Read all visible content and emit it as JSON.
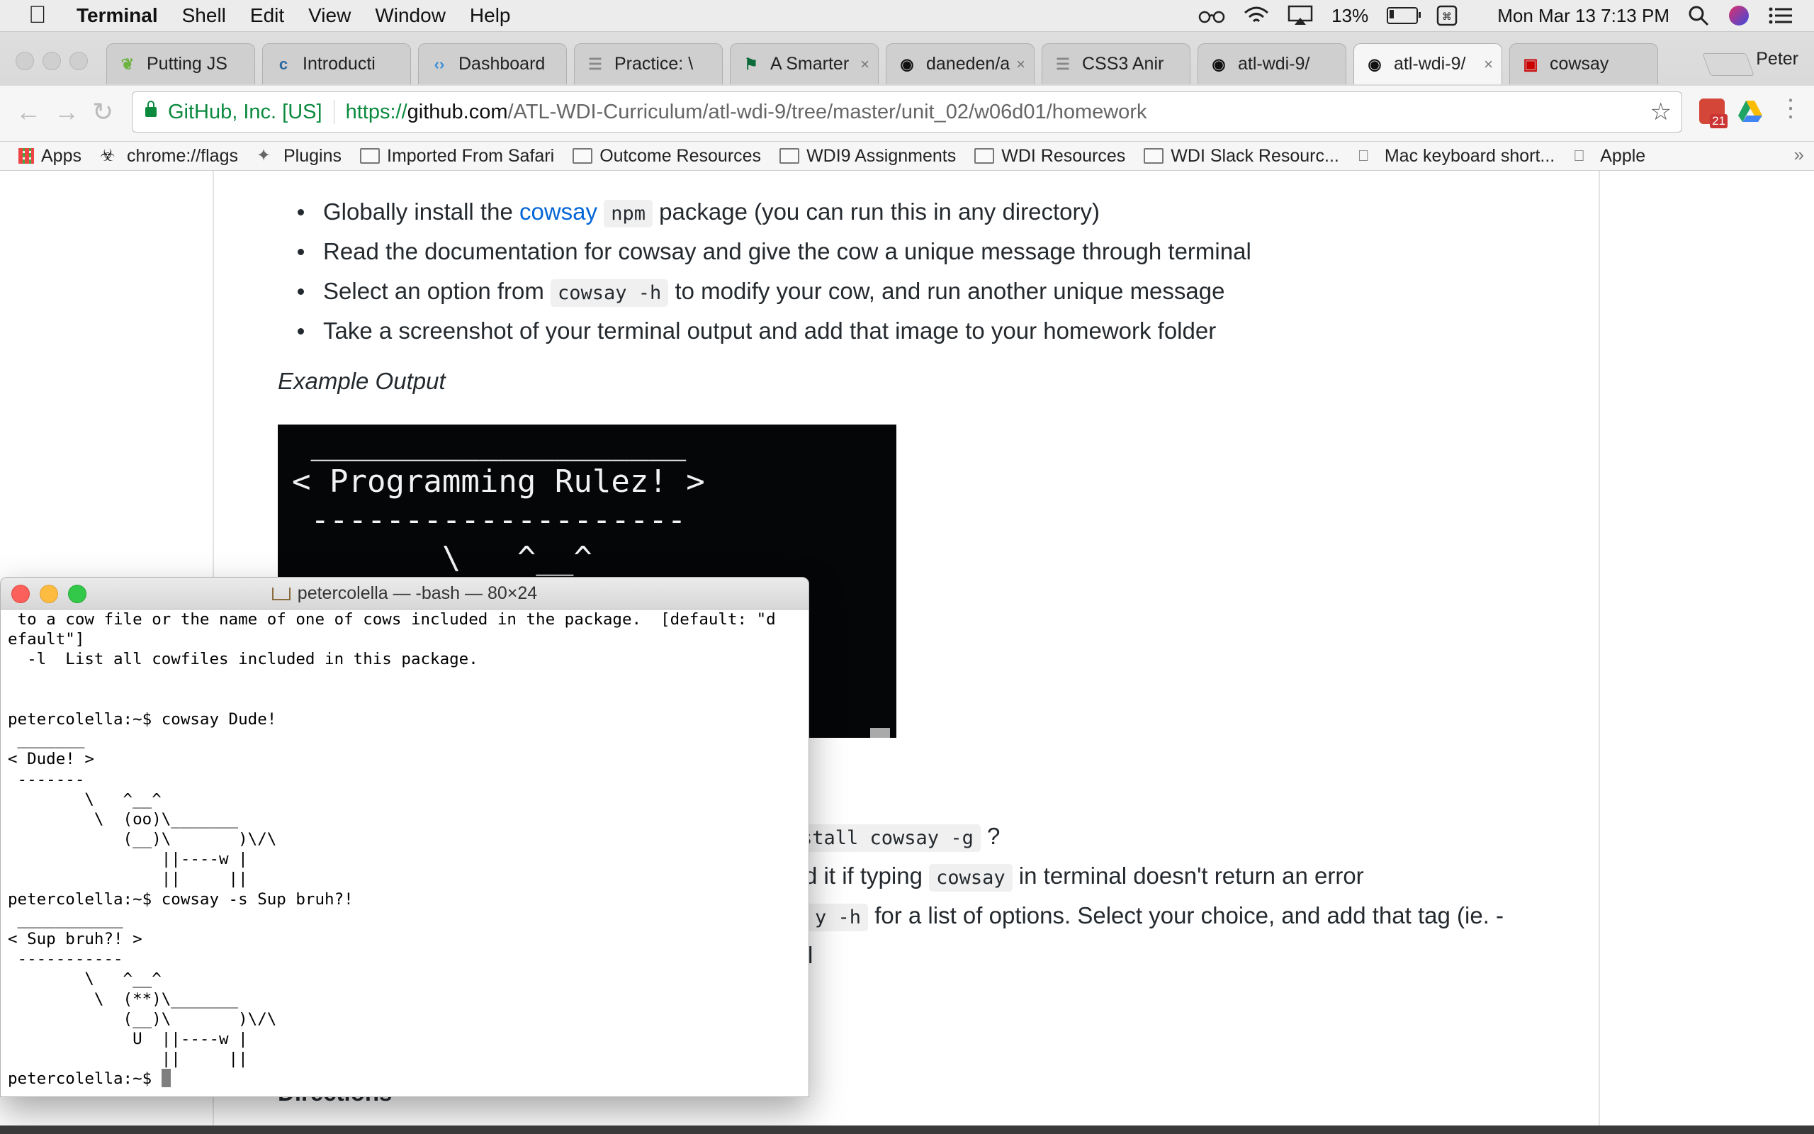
{
  "menubar": {
    "app": "Terminal",
    "items": [
      "Shell",
      "Edit",
      "View",
      "Window",
      "Help"
    ],
    "battery": "13%",
    "datetime": "Mon Mar 13  7:13 PM"
  },
  "tabs": [
    {
      "label": "Putting JS",
      "icon": "leaf-icon",
      "color": "#6db33f"
    },
    {
      "label": "Introducti",
      "icon": "doc-c-icon",
      "color": "#2d6a9f"
    },
    {
      "label": "Dashboard",
      "icon": "code-bracket-icon",
      "color": "#3a8ed6"
    },
    {
      "label": "Practice: \\",
      "icon": "page-icon",
      "color": "#888888"
    },
    {
      "label": "A Smarter",
      "icon": "flag-icon",
      "color": "#0b6b3a"
    },
    {
      "label": "daneden/a",
      "icon": "github-icon",
      "color": "#111111"
    },
    {
      "label": "CSS3 Anir",
      "icon": "page-icon",
      "color": "#888888"
    },
    {
      "label": "atl-wdi-9/",
      "icon": "github-icon",
      "color": "#111111"
    },
    {
      "label": "atl-wdi-9/",
      "icon": "github-icon",
      "color": "#111111"
    },
    {
      "label": "cowsay",
      "icon": "npm-icon",
      "color": "#cb0000"
    }
  ],
  "profile_name": "Peter",
  "omnibox": {
    "org": "GitHub, Inc. [US]",
    "scheme": "https://",
    "host": "github.com",
    "path": "/ATL-WDI-Curriculum/atl-wdi-9/tree/master/unit_02/w06d01/homework"
  },
  "extension_badge": "21",
  "bookmarks": [
    {
      "label": "Apps",
      "icon": "apps-grid-icon"
    },
    {
      "label": "chrome://flags",
      "icon": "flags-icon"
    },
    {
      "label": "Plugins",
      "icon": "puzzle-icon"
    },
    {
      "label": "Imported From Safari",
      "icon": "folder-icon"
    },
    {
      "label": "Outcome Resources",
      "icon": "folder-icon"
    },
    {
      "label": "WDI9 Assignments",
      "icon": "folder-icon"
    },
    {
      "label": "WDI Resources",
      "icon": "folder-icon"
    },
    {
      "label": "WDI Slack Resourc...",
      "icon": "folder-icon"
    },
    {
      "label": "Mac keyboard short...",
      "icon": "apple-icon"
    },
    {
      "label": "Apple",
      "icon": "apple-icon"
    }
  ],
  "page": {
    "bullets": [
      {
        "pre": "Globally install the ",
        "link": "cowsay",
        "code": "npm",
        "post": " package (you can run this in any directory)"
      },
      {
        "pre": "Read the documentation for cowsay and give the cow a unique message through terminal"
      },
      {
        "pre": "Select an option from ",
        "code": "cowsay -h",
        "post": " to modify your cow, and run another unique message"
      },
      {
        "pre": "Take a screenshot of your terminal output and add that image to your homework folder"
      }
    ],
    "example_label": "Example Output",
    "example_lines": [
      " ____________________",
      "< Programming Rulez! >",
      " --------------------",
      "        \\   ^__^",
      "                      /\\"
    ],
    "partial": {
      "l1_code": "stall cowsay -g",
      "l1_post": " ?",
      "l2_pre": "d it if typing ",
      "l2_code": "cowsay",
      "l2_post": " in terminal doesn't return an error",
      "l3_code": "y -h",
      "l3_post": " for a list of options. Select your choice, and add that tag (ie. -",
      "l4": "l"
    },
    "directions": "Directions"
  },
  "terminal": {
    "title": "petercolella — -bash — 80×24",
    "lines": [
      " to a cow file or the name of one of cows included in the package.  [default: \"d",
      "efault\"]",
      "  -l  List all cowfiles included in this package.",
      "",
      "",
      "petercolella:~$ cowsay Dude!",
      " _______",
      "< Dude! >",
      " -------",
      "        \\   ^__^",
      "         \\  (oo)\\_______",
      "            (__)\\       )\\/\\",
      "                ||----w |",
      "                ||     ||",
      "petercolella:~$ cowsay -s Sup bruh?!",
      " ___________",
      "< Sup bruh?! >",
      " -----------",
      "        \\   ^__^",
      "         \\  (**)\\_______",
      "            (__)\\       )\\/\\",
      "             U  ||----w |",
      "                ||     ||"
    ],
    "prompt": "petercolella:~$ "
  }
}
